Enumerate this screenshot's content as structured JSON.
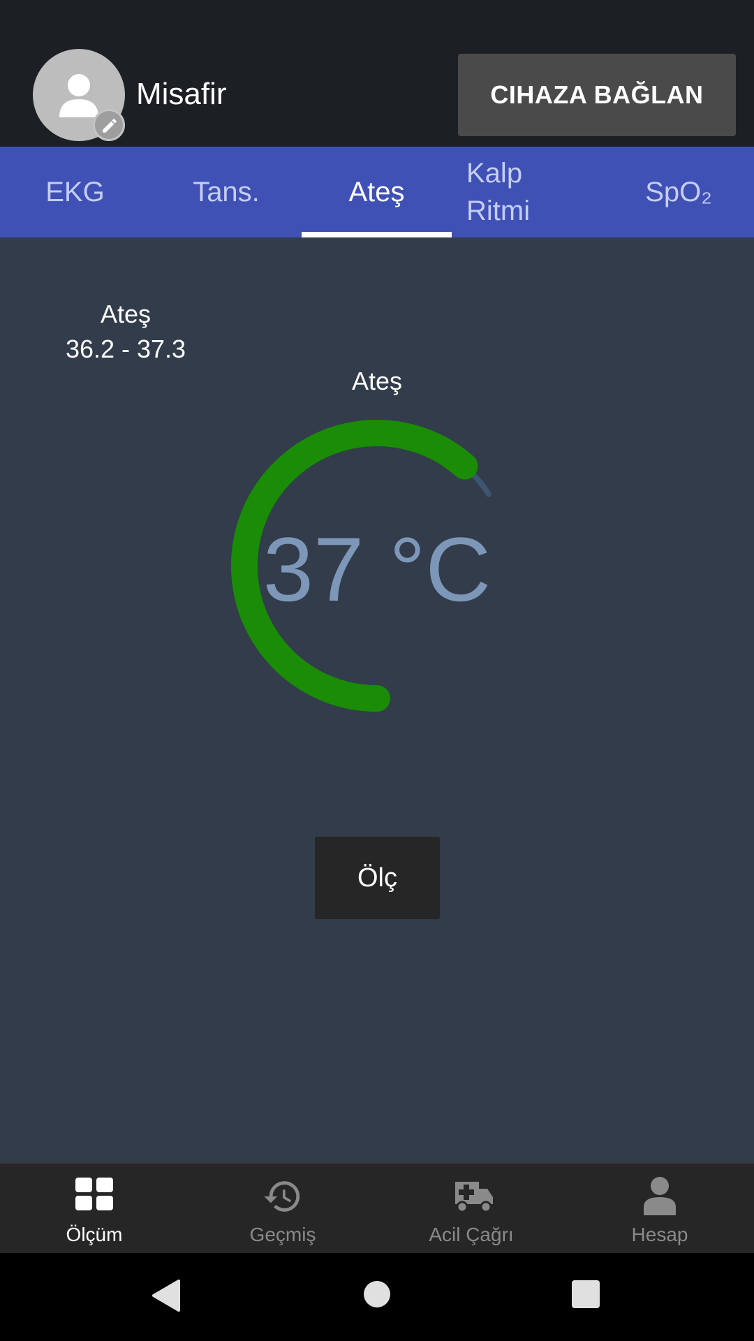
{
  "header": {
    "user_name": "Misafir",
    "connect_label": "CIHAZA BAĞLAN"
  },
  "tabs": [
    {
      "label": "EKG"
    },
    {
      "label": "Tans."
    },
    {
      "label": "Ateş"
    },
    {
      "label": "Kalp Ritmi"
    },
    {
      "label": "SpO₂"
    }
  ],
  "active_tab": "Ateş",
  "measurement": {
    "range_title": "Ateş",
    "range_value": "36.2 - 37.3",
    "gauge_title": "Ateş",
    "gauge_value": "37 °C",
    "gauge_fraction": 0.82,
    "measure_label": "Ölç"
  },
  "colors": {
    "tab_bar": "#3f51b5",
    "gauge_fill": "#1a8c05",
    "gauge_track": "#3c5570",
    "value_text": "#7d97b8"
  },
  "bottom_nav": [
    {
      "label": "Ölçüm",
      "icon": "dashboard-icon"
    },
    {
      "label": "Geçmiş",
      "icon": "history-icon"
    },
    {
      "label": "Acil Çağrı",
      "icon": "ambulance-icon"
    },
    {
      "label": "Hesap",
      "icon": "person-icon"
    }
  ],
  "system_bar": [
    "back-icon",
    "home-icon",
    "recents-icon"
  ]
}
